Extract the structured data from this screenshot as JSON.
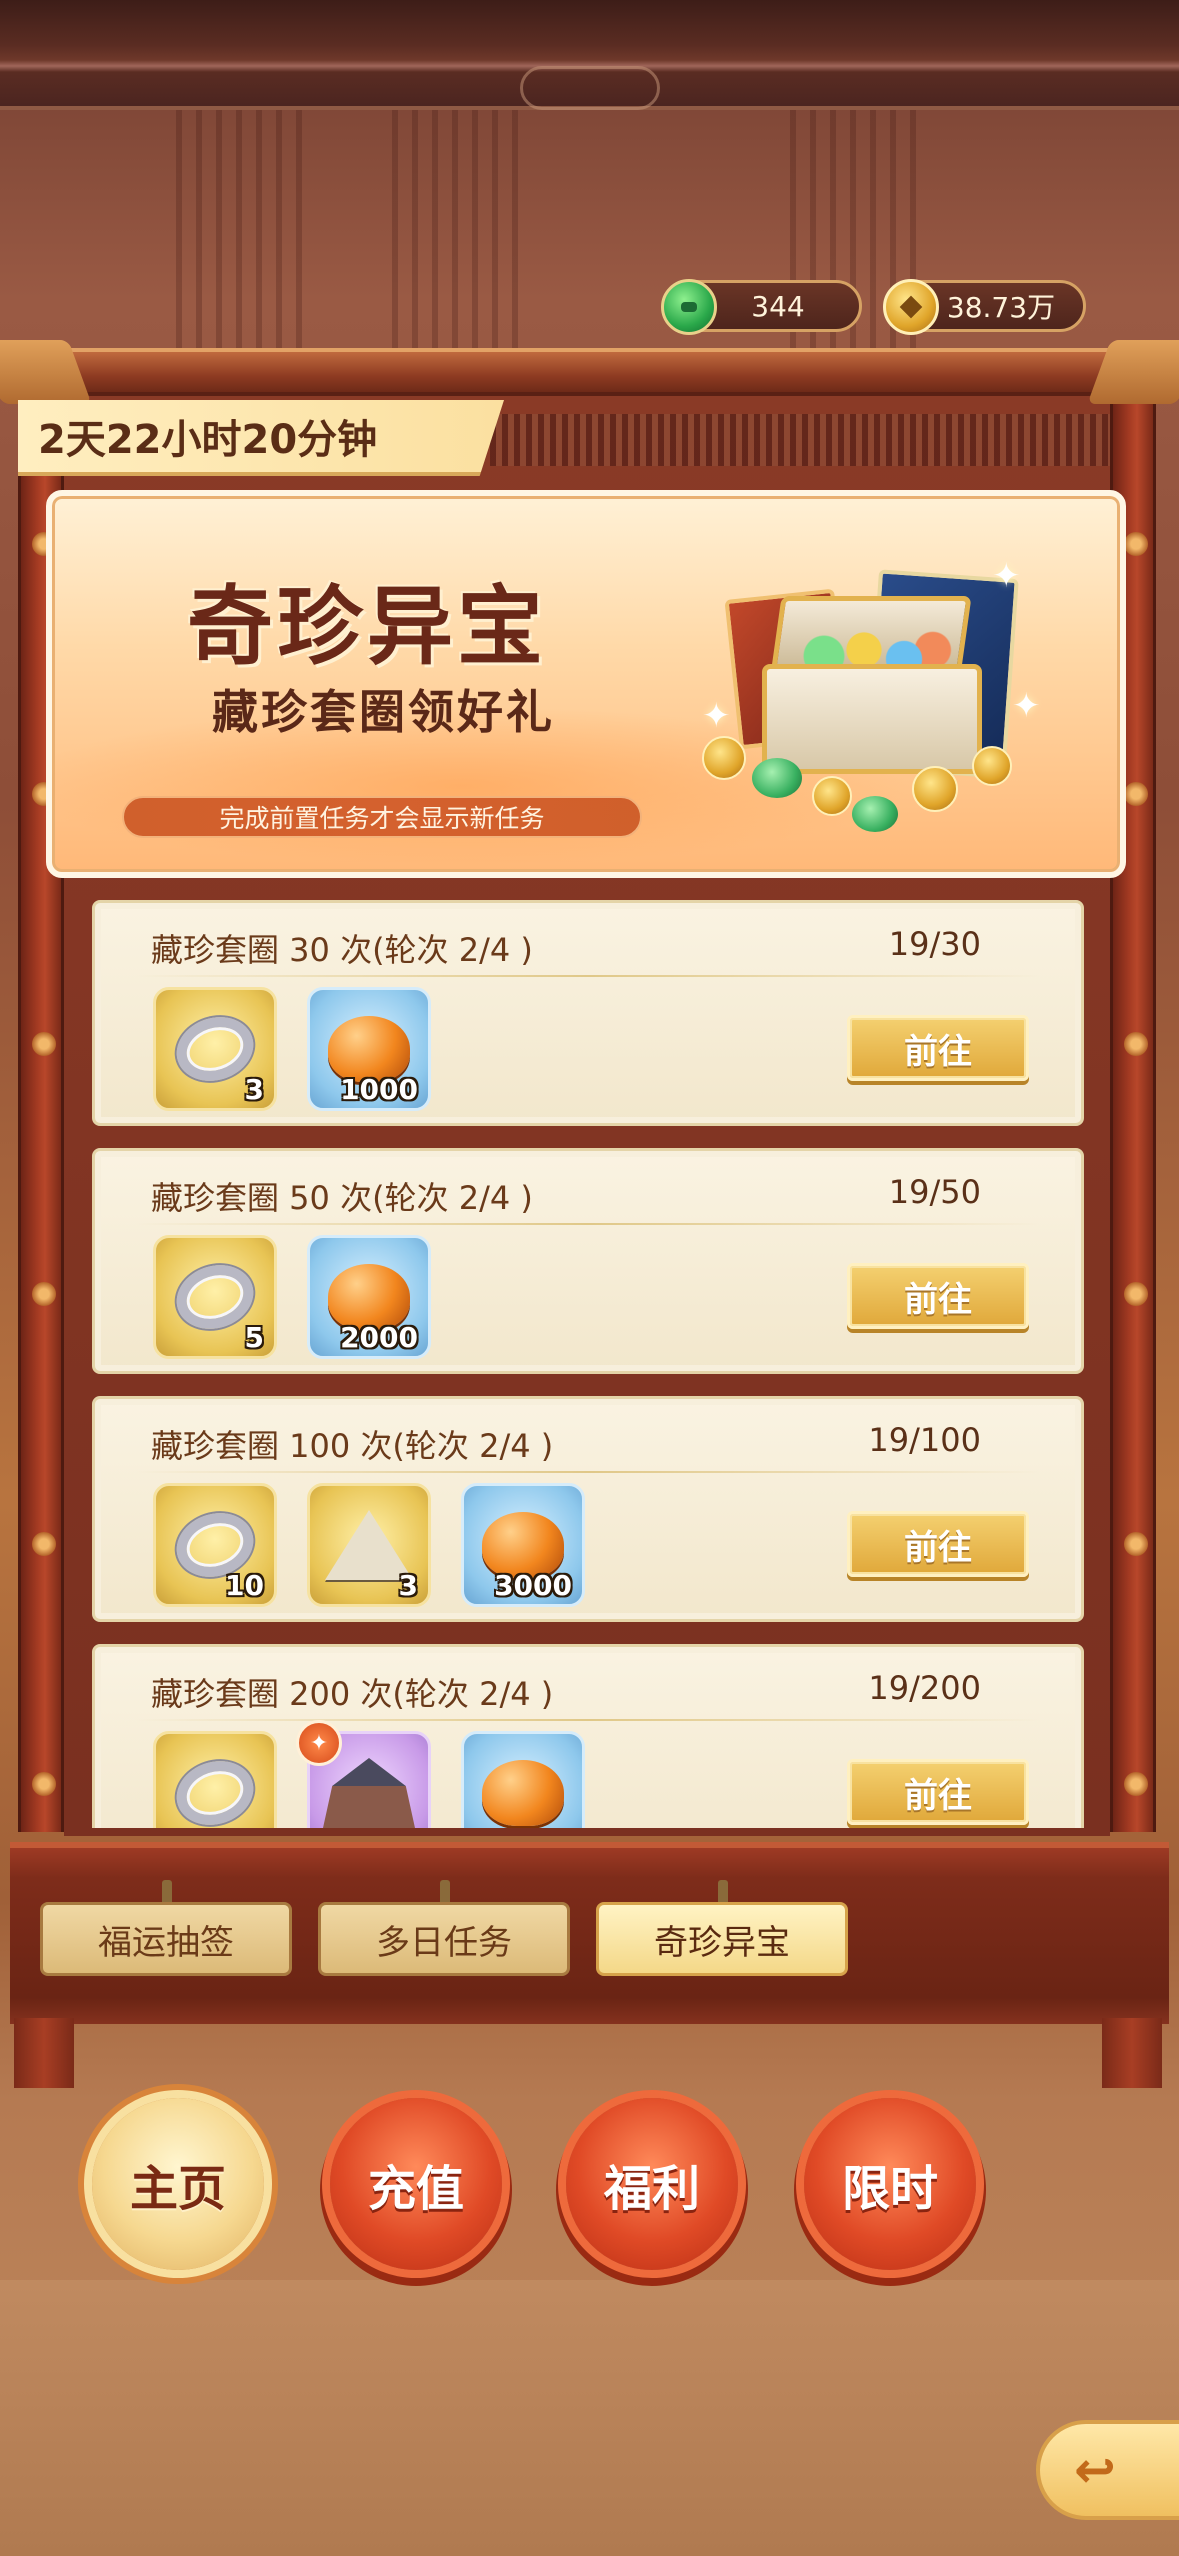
{
  "currency": {
    "jade": {
      "icon": "jade-coin-icon",
      "value": "344"
    },
    "coins": {
      "icon": "copper-coin-icon",
      "value": "38.73万"
    }
  },
  "event": {
    "timer": "2天22小时20分钟",
    "banner": {
      "title": "奇珍异宝",
      "subtitle": "藏珍套圈领好礼",
      "note": "完成前置任务才会显示新任务"
    }
  },
  "tasks": [
    {
      "title": "藏珍套圈 30 次(轮次 2/4 )",
      "progress": "19/30",
      "rewards": [
        {
          "icon": "silver-ring-icon",
          "bg": "gold",
          "count": "3"
        },
        {
          "icon": "amber-icon",
          "bg": "blue",
          "count": "1000"
        }
      ],
      "button": "前往"
    },
    {
      "title": "藏珍套圈 50 次(轮次 2/4 )",
      "progress": "19/50",
      "rewards": [
        {
          "icon": "silver-ring-icon",
          "bg": "gold",
          "count": "5"
        },
        {
          "icon": "amber-icon",
          "bg": "blue",
          "count": "2000"
        }
      ],
      "button": "前往"
    },
    {
      "title": "藏珍套圈 100 次(轮次 2/4 )",
      "progress": "19/100",
      "rewards": [
        {
          "icon": "silver-ring-icon",
          "bg": "gold",
          "count": "10"
        },
        {
          "icon": "tent-icon",
          "bg": "gold",
          "count": "3"
        },
        {
          "icon": "amber-icon",
          "bg": "blue",
          "count": "3000"
        }
      ],
      "button": "前往"
    },
    {
      "title": "藏珍套圈 200 次(轮次 2/4 )",
      "progress": "19/200",
      "rewards": [
        {
          "icon": "silver-ring-icon",
          "bg": "gold",
          "count": ""
        },
        {
          "icon": "building-icon",
          "bg": "purple",
          "count": ""
        },
        {
          "icon": "amber-icon",
          "bg": "blue",
          "count": ""
        }
      ],
      "button": "前往"
    }
  ],
  "tabs": [
    {
      "label": "福运抽签",
      "active": false
    },
    {
      "label": "多日任务",
      "active": false
    },
    {
      "label": "奇珍异宝",
      "active": true
    }
  ],
  "nav": [
    {
      "label": "主页",
      "active": true
    },
    {
      "label": "充值",
      "active": false
    },
    {
      "label": "福利",
      "active": false
    },
    {
      "label": "限时",
      "active": false
    }
  ],
  "back": {
    "icon": "back-arrow-icon"
  },
  "colors": {
    "frame_red": "#a33a22",
    "card_bg": "#faf3e2",
    "button_gold": "#e0a83a",
    "nav_red": "#e04a26"
  }
}
